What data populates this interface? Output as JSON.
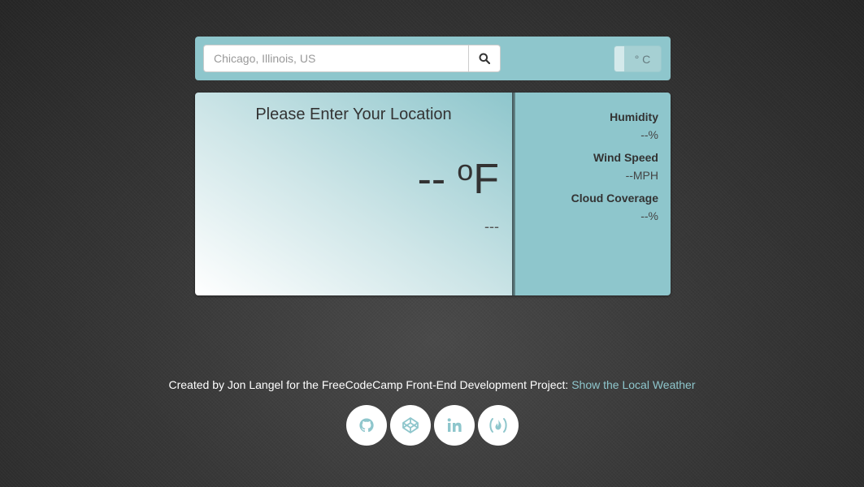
{
  "search": {
    "placeholder": "Chicago, Illinois, US",
    "button_icon": "search-icon"
  },
  "unit_toggle": {
    "label": "° C"
  },
  "weather": {
    "location": "Please Enter Your Location",
    "temperature_value": "--",
    "temperature_degree": "o",
    "temperature_unit": "F",
    "description": "---"
  },
  "stats": [
    {
      "label": "Humidity",
      "value": "--%"
    },
    {
      "label": "Wind Speed",
      "value": "--MPH"
    },
    {
      "label": "Cloud Coverage",
      "value": "--%"
    }
  ],
  "footer": {
    "text": "Created by Jon Langel for the FreeCodeCamp Front-End Development Project: ",
    "link_text": "Show the Local Weather"
  },
  "social_links": [
    {
      "icon": "github-icon"
    },
    {
      "icon": "codepen-icon"
    },
    {
      "icon": "linkedin-icon"
    },
    {
      "icon": "freecodecamp-icon"
    }
  ],
  "colors": {
    "accent": "#8ec6cc",
    "background": "#333333",
    "text_dark": "#333333"
  }
}
